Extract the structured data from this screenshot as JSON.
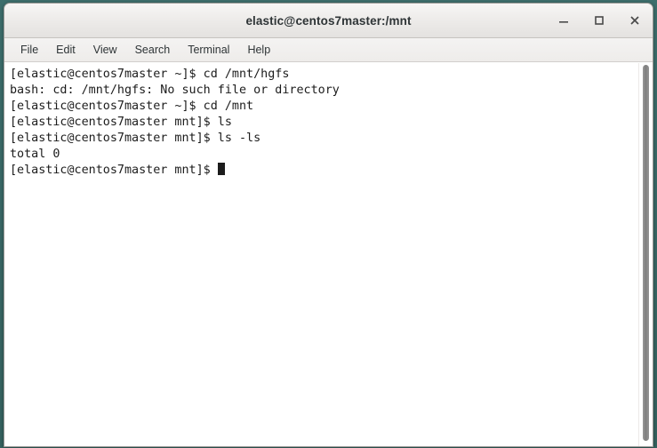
{
  "window": {
    "title": "elastic@centos7master:/mnt",
    "controls": [
      {
        "name": "minimize-button",
        "label": "Minimize"
      },
      {
        "name": "maximize-button",
        "label": "Maximize"
      },
      {
        "name": "close-button",
        "label": "Close"
      }
    ]
  },
  "menubar": {
    "items": [
      {
        "label": "File"
      },
      {
        "label": "Edit"
      },
      {
        "label": "View"
      },
      {
        "label": "Search"
      },
      {
        "label": "Terminal"
      },
      {
        "label": "Help"
      }
    ]
  },
  "terminal": {
    "background_color": "#ffffff",
    "text_color": "#1c1c1c",
    "lines": [
      "[elastic@centos7master ~]$ cd /mnt/hgfs",
      "bash: cd: /mnt/hgfs: No such file or directory",
      "[elastic@centos7master ~]$ cd /mnt",
      "[elastic@centos7master mnt]$ ls",
      "[elastic@centos7master mnt]$ ls -ls",
      "total 0"
    ],
    "prompt": "[elastic@centos7master mnt]$ ",
    "cursor": "block"
  },
  "scrollbar": {
    "orientation": "vertical",
    "thumb_color": "#7e7e7e"
  }
}
